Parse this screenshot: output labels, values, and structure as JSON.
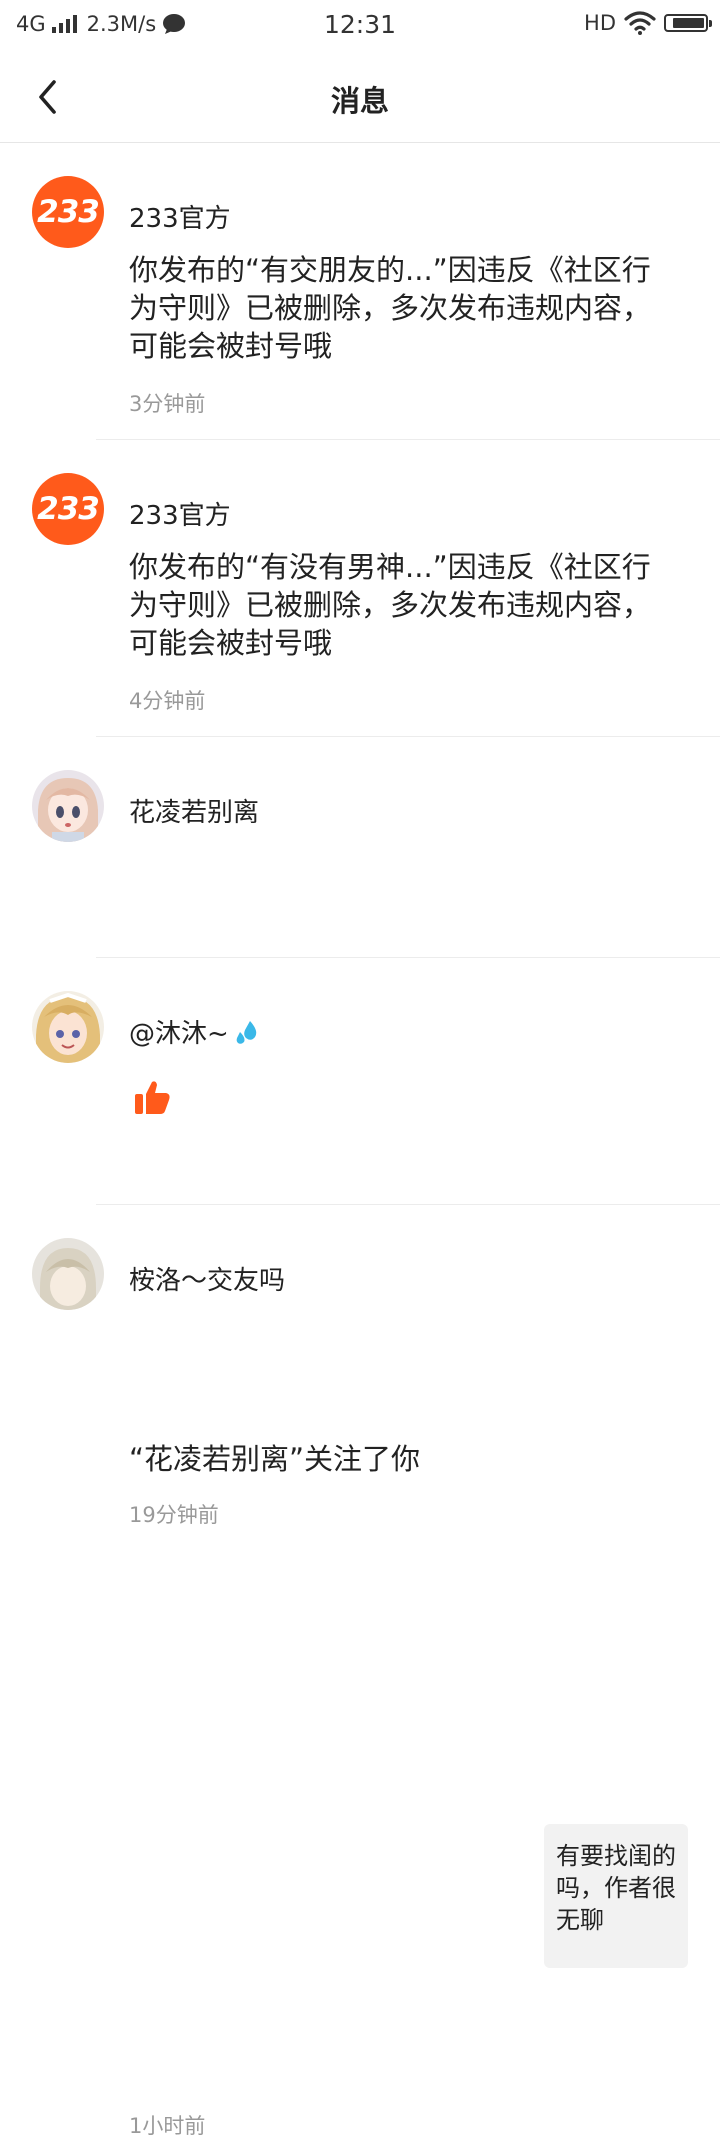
{
  "status_bar": {
    "network": "4G",
    "speed": "2.3M/s",
    "time": "12:31",
    "hd": "HD",
    "battery_level": 0.85
  },
  "nav": {
    "title": "消息"
  },
  "messages": [
    {
      "name": "233官方",
      "avatar": "233-logo",
      "content": "你发布的“有交朋友的...”因违反《社区行为守则》已被删除，多次发布违规内容，可能会被封号哦",
      "time": "3分钟前"
    },
    {
      "name": "233官方",
      "avatar": "233-logo",
      "content": "你发布的“有没有男神...”因违反《社区行为守则》已被删除，多次发布违规内容，可能会被封号哦",
      "time": "4分钟前"
    },
    {
      "name": "花凌若别离",
      "avatar": "anime-avatar",
      "content": "“花凌若别离”关注了你",
      "time": "19分钟前"
    },
    {
      "name": "@沐沐~",
      "name_icon": "water-drops-icon",
      "avatar": "anime-avatar",
      "like_icon": "thumbs-up-icon",
      "time": "1小时前",
      "quoted_post": "有要找闺的吗，作者很无聊"
    },
    {
      "name": "桉洛～交友吗",
      "avatar": "anime-avatar"
    }
  ],
  "colors": {
    "brand": "#ff5a1b",
    "like": "#ff5a1b",
    "drop": "#3ab8e8"
  }
}
